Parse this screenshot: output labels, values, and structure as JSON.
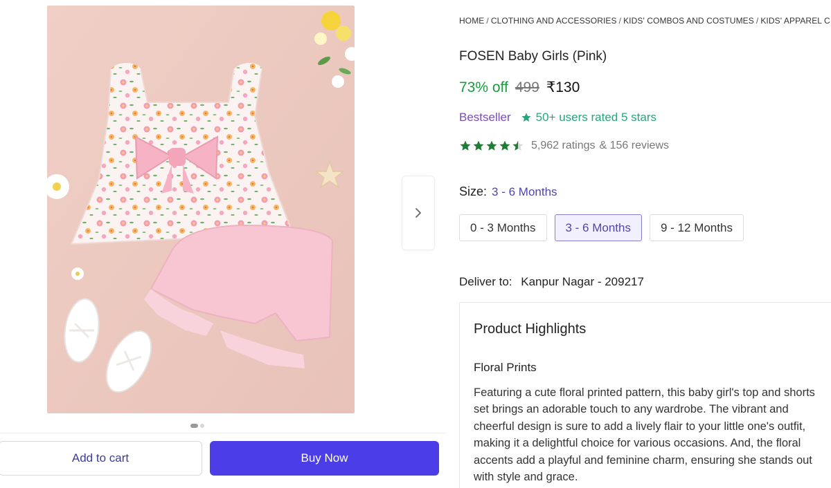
{
  "breadcrumb": [
    "HOME",
    "CLOTHING AND ACCESSORIES",
    "KIDS' COMBOS AND COSTUMES",
    "KIDS' APPAREL C"
  ],
  "product": {
    "title": "FOSEN Baby Girls (Pink)",
    "discount": "73% off",
    "mrp": "499",
    "price": "₹130"
  },
  "badges": {
    "bestseller": "Bestseller",
    "users_rated": "50+ users rated 5 stars",
    "users_rated_icon": "star-badge-icon"
  },
  "rating": {
    "stars": 4.5,
    "max": 5,
    "ratings_text": "5,962 ratings",
    "reviews_text": "& 156 reviews",
    "star_color": "#1e7d34"
  },
  "size": {
    "label": "Size:",
    "selected": "3 - 6 Months",
    "options": [
      "0 - 3 Months",
      "3 - 6 Months",
      "9 - 12 Months"
    ]
  },
  "delivery": {
    "label": "Deliver to:",
    "location": "Kanpur Nagar - 209217"
  },
  "highlights": {
    "title": "Product Highlights",
    "subtitle": "Floral Prints",
    "body": "Featuring a cute floral printed pattern, this baby girl's top and shorts set brings an adorable touch to any wardrobe. The vibrant and cheerful design is sure to add a lively flair to your little one's outfit, making it a delightful choice for various occasions. And, the floral accents add a playful and feminine charm, ensuring she stands out with style and grace."
  },
  "gallery": {
    "image_count": 2,
    "active_index": 0,
    "next_icon": "chevron-right-icon"
  },
  "actions": {
    "add_to_cart": "Add to cart",
    "buy_now": "Buy Now"
  },
  "colors": {
    "discount": "#1a9a3c",
    "bestseller": "#7b4bb3",
    "users_rated": "#2aa37a",
    "buy_button": "#4c3ee6",
    "size_selected": "#4e47a8"
  }
}
